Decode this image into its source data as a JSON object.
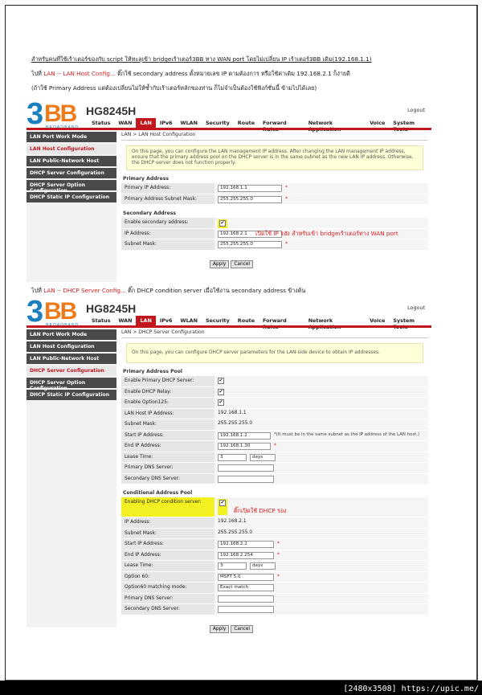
{
  "instructions": {
    "line1": "สำหรับคนที่ใช้เร้าเตอร์ของกับ script ให้ทะลุเข้า bridgeเร้าเตอร์3BB ทาง WAN port โดยไม่เปลี่ยน IP เร้าเตอร์3BB เดิม(192.168.1.1)",
    "line2_prefix": "ไปที่",
    "line2_link": "LAN -- LAN Host Config...",
    "line2_rest": "ติ๊กใช้ secondary address ตั้งหมายเลข IP ตามต้องการ หรือใช้ค่าเดิม 192.168.2.1 ก็ง่ายดี",
    "line3": "(ถ้าใช้ Primary Address แต่ต้องเปลี่ยนไม่ให้ซ้ำกับเร้าเตอร์หลักของท่าน ก็ไม่จำเป็นต้องใช้ฟังก์ชั่นนี้ ข้ามไปได้เลย)",
    "line4_prefix": "ไปที่",
    "line4_link": "LAN -- DHCP Server Config...",
    "line4_rest": "ติ๊ก DHCP condition server เมื่อใช้งาน secondary address ข้างต้น"
  },
  "router": {
    "brand_digit": "3",
    "brand_letters": "BB",
    "brand_sub": "BROADBAND",
    "model": "HG8245H",
    "logout": "Logout",
    "nav": [
      "Status",
      "WAN",
      "LAN",
      "IPv6",
      "WLAN",
      "Security",
      "Route",
      "Forward Rules",
      "Network Application",
      "Voice",
      "System Tools"
    ],
    "nav_active": "LAN"
  },
  "shot1": {
    "sidebar": [
      "LAN Port Work Mode",
      "LAN Host Configuration",
      "LAN Public-Network Host",
      "DHCP Server Configuration",
      "DHCP Server Option Configuration",
      "DHCP Static IP Configuration"
    ],
    "selected": "LAN Host Configuration",
    "breadcrumb": "LAN > LAN Host Configuration",
    "info": "On this page, you can configure the LAN management IP address. After changing the LAN management IP address, ensure that the primary address pool on the DHCP server is in the same subnet as the new LAN IP address. Otherwise, the DHCP server does not function properly.",
    "primary_title": "Primary Address",
    "primary_ip_label": "Primary IP Address:",
    "primary_ip": "192.168.1.1",
    "primary_mask_label": "Primary Address Subnet Mask:",
    "primary_mask": "255.255.255.0",
    "secondary_title": "Secondary Address",
    "enable_secondary_label": "Enable secondary address:",
    "ip_label": "IP Address:",
    "ip": "192.168.2.1",
    "mask_label": "Subnet Mask:",
    "mask": "255.255.255.0",
    "apply": "Apply",
    "cancel": "Cancel",
    "annotation": "เปิดใช้ IP รอง สำหรับเข้า bridgeเร้าเตอร์ทาง WAN port"
  },
  "shot2": {
    "sidebar": [
      "LAN Port Work Mode",
      "LAN Host Configuration",
      "LAN Public-Network Host",
      "DHCP Server Configuration",
      "DHCP Server Option Configuration",
      "DHCP Static IP Configuration"
    ],
    "selected": "DHCP Server Configuration",
    "breadcrumb": "LAN > DHCP Server Configuration",
    "info": "On this page, you can configure DHCP server parameters for the LAN-side device to obtain IP addresses.",
    "pool_title": "Primary Address Pool",
    "enable_primary_label": "Enable Primary DHCP Server:",
    "enable_relay_label": "Enable DHCP Relay:",
    "enable_opt125_label": "Enable Option125:",
    "lan_ip_label": "LAN Host IP Address:",
    "lan_ip": "192.168.1.1",
    "subnet_label": "Subnet Mask:",
    "subnet": "255.255.255.0",
    "start_label": "Start IP Address:",
    "start_ip": "192.168.1.2",
    "start_note": "*(It must be in the same subnet as the IP address of the LAN host.)",
    "end_label": "End IP Address:",
    "end_ip": "192.168.1.30",
    "lease_label": "Lease Time:",
    "lease": "3",
    "lease_unit": "days",
    "pdns_label": "Primary DNS Server:",
    "sdns_label": "Secondary DNS Server:",
    "cond_title": "Conditional Address Pool",
    "cond_enable_label": "Enabling DHCP condition server:",
    "cond_ip_label": "IP Address:",
    "cond_ip": "192.168.2.1",
    "cond_mask_label": "Subnet Mask:",
    "cond_mask": "255.255.255.0",
    "cond_start_label": "Start IP Address:",
    "cond_start": "192.168.2.2",
    "cond_end_label": "End IP Address:",
    "cond_end": "192.168.2.254",
    "cond_lease_label": "Lease Time:",
    "cond_lease": "3",
    "cond_lease_unit": "days",
    "opt60_label": "Option 60:",
    "opt60": "MSFT 5.0",
    "opt60_mode_label": "Option60 matching mode:",
    "opt60_mode": "Exact match",
    "cond_pdns_label": "Primary DNS Server:",
    "cond_sdns_label": "Secondary DNS Server:",
    "apply": "Apply",
    "cancel": "Cancel",
    "annotation": "ติ๊กเปิดใช้ DHCP รอง"
  },
  "footer": "[2480x3508] https://upic.me/"
}
